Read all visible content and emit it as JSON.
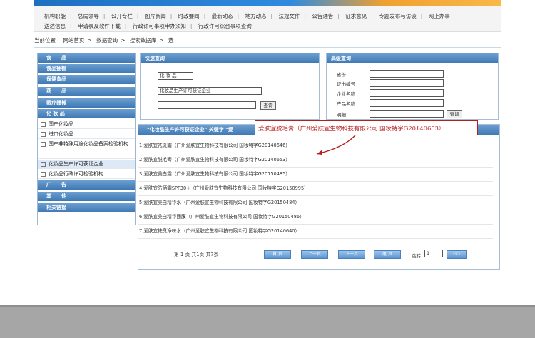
{
  "nav": {
    "row1": [
      "机构职能",
      "总局领导",
      "公开专栏",
      "图片新闻",
      "时政要闻",
      "最新动态",
      "地方动态",
      "法规文件",
      "公告通告",
      "征求意见",
      "专题发布与访谈",
      "网上办事"
    ],
    "row2": [
      "送达信息",
      "申请表及软件下载",
      "行政许可事项申办须知",
      "行政许可综合事项查询"
    ]
  },
  "breadcrumb": {
    "label": "当前位置",
    "items": [
      "网站首页",
      "数据查询",
      "搜索数据库",
      "选"
    ]
  },
  "sidebar": {
    "categories": [
      "食　　品",
      "食品抽检",
      "保健食品",
      "药　　品",
      "医疗器械",
      "化 妆 品"
    ],
    "sub_items": [
      "国产化妆品",
      "进口化妆品",
      "国产非特殊用途化妆品备案检验机构",
      "化妆品生产许可获证企业",
      "化妆品行政许可检验机构"
    ],
    "bottom_categories": [
      "广　　告",
      "其　　他",
      "相关链接"
    ]
  },
  "quick": {
    "title": "快速查询",
    "select1": "化 妆 品",
    "select2": "化妆品生产许可获证企业",
    "button": "查询"
  },
  "advanced": {
    "title": "高级查询",
    "fields": [
      "省份",
      "证书编号",
      "企业名称",
      "产品名称",
      "明细"
    ],
    "button": "查询"
  },
  "results": {
    "header": "\"化妆品生产许可获证企业\" 关键字 \"爱",
    "items": [
      "1.爱肤宜祛斑霜（广州爱肤宜生物科技有限公司 国妆特字G20140646）",
      "2.爱肤宜脱毛膏（广州爱肤宜生物科技有限公司 国妆特字G20140653）",
      "3.爱肤宜美白霜（广州爱肤宜生物科技有限公司 国妆特字G20150485）",
      "4.爱肤宜防晒霜SPF30+（广州爱肤宜生物科技有限公司 国妆特字G20150995）",
      "5.爱肤宜美白精华水（广州爱肤宜生物科技有限公司 国妆特字G20150484）",
      "6.爱肤宜美白精华面膜（广州爱肤宜生物科技有限公司 国妆特字G20150486）",
      "7.爱肤宜祛臭净味水（广州爱肤宜生物科技有限公司 国妆特字G20140640）"
    ],
    "pager": {
      "info": "第 1 页 共1页 共7条",
      "first": "首 页",
      "prev": "上一页",
      "next": "下一页",
      "last": "尾 页",
      "jump": "跳转",
      "page_value": "1",
      "go": "GO"
    }
  },
  "tooltip": "爱肤宜脱毛膏（广州爱肤宜生物科技有限公司 国妆特字G20140653）"
}
